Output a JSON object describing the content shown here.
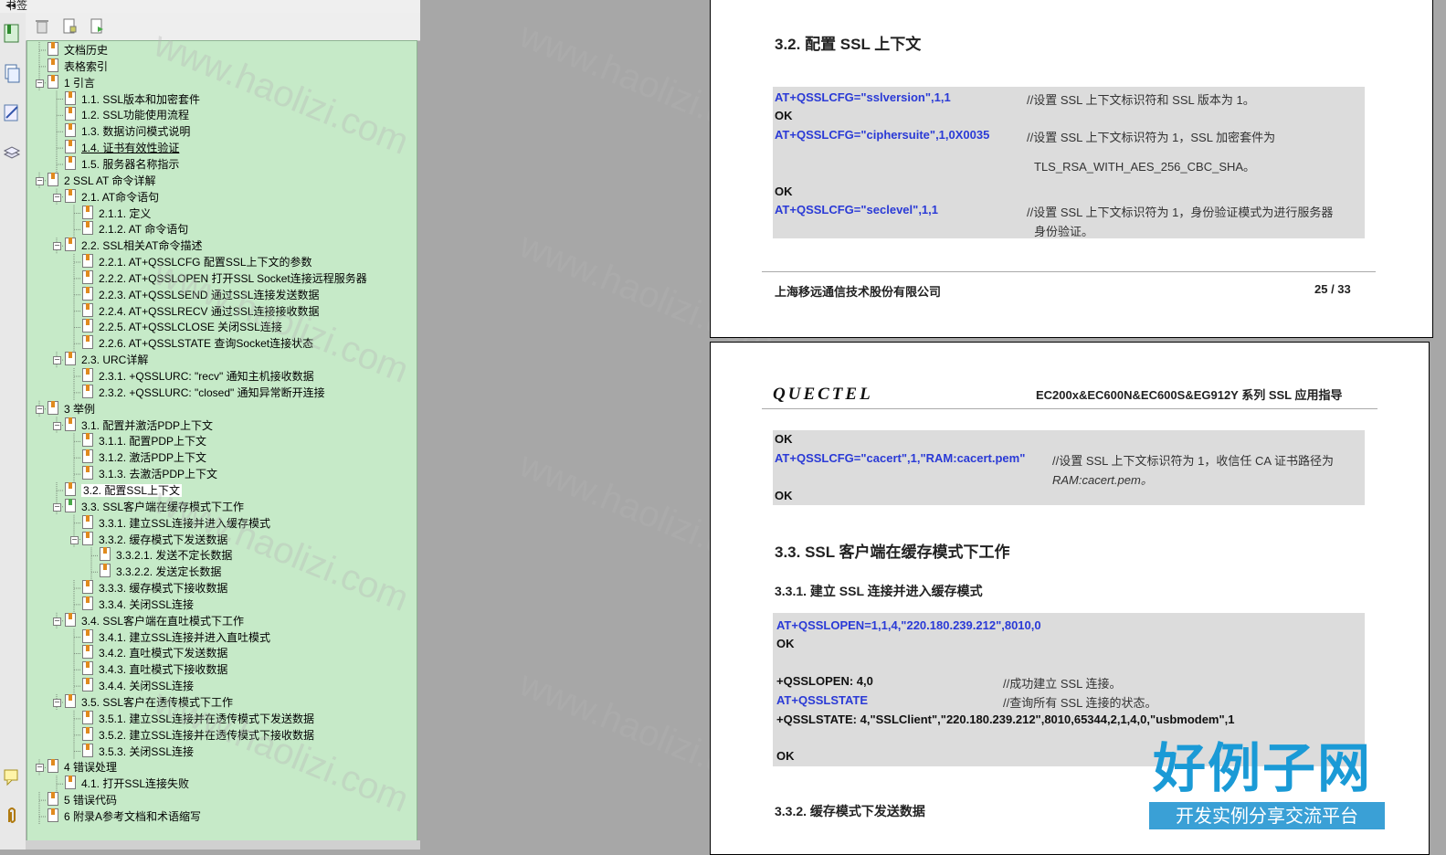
{
  "panel": {
    "title": "书签",
    "collapse_icon": "double-left-arrow"
  },
  "toolbar": {
    "icons": [
      "delete-bookmark-icon",
      "expand-bookmark-icon",
      "new-bookmark-icon"
    ]
  },
  "strip_icons": [
    "bookmarks-icon",
    "pages-icon",
    "signatures-icon",
    "layers-icon",
    "comments-icon",
    "attachments-icon"
  ],
  "bookmarks": [
    {
      "label": "文档历史",
      "level": 0,
      "toggle": ""
    },
    {
      "label": "表格索引",
      "level": 0,
      "toggle": ""
    },
    {
      "label": "1 引言",
      "level": 0,
      "toggle": "−"
    },
    {
      "label": "1.1. SSL版本和加密套件",
      "level": 1,
      "toggle": ""
    },
    {
      "label": "1.2. SSL功能使用流程",
      "level": 1,
      "toggle": ""
    },
    {
      "label": "1.3. 数据访问模式说明",
      "level": 1,
      "toggle": ""
    },
    {
      "label": "1.4. 证书有效性验证",
      "level": 1,
      "toggle": "",
      "underline": true
    },
    {
      "label": "1.5. 服务器名称指示",
      "level": 1,
      "toggle": ""
    },
    {
      "label": "2 SSL AT 命令详解",
      "level": 0,
      "toggle": "−"
    },
    {
      "label": "2.1. AT命令语句",
      "level": 1,
      "toggle": "−"
    },
    {
      "label": "2.1.1. 定义",
      "level": 2,
      "toggle": ""
    },
    {
      "label": "2.1.2. AT 命令语句",
      "level": 2,
      "toggle": ""
    },
    {
      "label": "2.2. SSL相关AT命令描述",
      "level": 1,
      "toggle": "−"
    },
    {
      "label": "2.2.1. AT+QSSLCFG  配置SSL上下文的参数",
      "level": 2,
      "toggle": ""
    },
    {
      "label": "2.2.2. AT+QSSLOPEN  打开SSL Socket连接远程服务器",
      "level": 2,
      "toggle": ""
    },
    {
      "label": "2.2.3. AT+QSSLSEND  通过SSL连接发送数据",
      "level": 2,
      "toggle": ""
    },
    {
      "label": "2.2.4. AT+QSSLRECV  通过SSL连接接收数据",
      "level": 2,
      "toggle": ""
    },
    {
      "label": "2.2.5. AT+QSSLCLOSE  关闭SSL连接",
      "level": 2,
      "toggle": ""
    },
    {
      "label": "2.2.6. AT+QSSLSTATE  查询Socket连接状态",
      "level": 2,
      "toggle": ""
    },
    {
      "label": "2.3. URC详解",
      "level": 1,
      "toggle": "−"
    },
    {
      "label": "2.3.1. +QSSLURC: \"recv\"  通知主机接收数据",
      "level": 2,
      "toggle": ""
    },
    {
      "label": "2.3.2. +QSSLURC: \"closed\"  通知异常断开连接",
      "level": 2,
      "toggle": ""
    },
    {
      "label": "3 举例",
      "level": 0,
      "toggle": "−"
    },
    {
      "label": "3.1. 配置并激活PDP上下文",
      "level": 1,
      "toggle": "−"
    },
    {
      "label": "3.1.1. 配置PDP上下文",
      "level": 2,
      "toggle": ""
    },
    {
      "label": "3.1.2. 激活PDP上下文",
      "level": 2,
      "toggle": ""
    },
    {
      "label": "3.1.3. 去激活PDP上下文",
      "level": 2,
      "toggle": ""
    },
    {
      "label": "3.2. 配置SSL上下文",
      "level": 1,
      "toggle": "",
      "selected": true
    },
    {
      "label": "3.3. SSL客户端在缓存模式下工作",
      "level": 1,
      "toggle": "−",
      "green": true
    },
    {
      "label": "3.3.1. 建立SSL连接并进入缓存模式",
      "level": 2,
      "toggle": ""
    },
    {
      "label": "3.3.2. 缓存模式下发送数据",
      "level": 2,
      "toggle": "−"
    },
    {
      "label": "3.3.2.1. 发送不定长数据",
      "level": 3,
      "toggle": ""
    },
    {
      "label": "3.3.2.2. 发送定长数据",
      "level": 3,
      "toggle": ""
    },
    {
      "label": "3.3.3. 缓存模式下接收数据",
      "level": 2,
      "toggle": ""
    },
    {
      "label": "3.3.4. 关闭SSL连接",
      "level": 2,
      "toggle": ""
    },
    {
      "label": "3.4. SSL客户端在直吐模式下工作",
      "level": 1,
      "toggle": "−"
    },
    {
      "label": "3.4.1. 建立SSL连接并进入直吐模式",
      "level": 2,
      "toggle": ""
    },
    {
      "label": "3.4.2. 直吐模式下发送数据",
      "level": 2,
      "toggle": ""
    },
    {
      "label": "3.4.3. 直吐模式下接收数据",
      "level": 2,
      "toggle": ""
    },
    {
      "label": "3.4.4. 关闭SSL连接",
      "level": 2,
      "toggle": ""
    },
    {
      "label": "3.5. SSL客户在透传模式下工作",
      "level": 1,
      "toggle": "−"
    },
    {
      "label": "3.5.1. 建立SSL连接并在透传模式下发送数据",
      "level": 2,
      "toggle": ""
    },
    {
      "label": "3.5.2. 建立SSL连接并在透传模式下接收数据",
      "level": 2,
      "toggle": ""
    },
    {
      "label": "3.5.3. 关闭SSL连接",
      "level": 2,
      "toggle": ""
    },
    {
      "label": "4 错误处理",
      "level": 0,
      "toggle": "−"
    },
    {
      "label": "4.1. 打开SSL连接失败",
      "level": 1,
      "toggle": ""
    },
    {
      "label": "5 错误代码",
      "level": 0,
      "toggle": ""
    },
    {
      "label": "6 附录A参考文档和术语缩写",
      "level": 0,
      "toggle": ""
    }
  ],
  "page1": {
    "heading": "3.2. 配置 SSL 上下文",
    "cmd1": "AT+QSSLCFG=\"sslversion\",1,1",
    "cmt1": "//设置 SSL 上下文标识符和 SSL 版本为 1。",
    "ok1": "OK",
    "cmd2": "AT+QSSLCFG=\"ciphersuite\",1,0X0035",
    "cmt2": "//设置 SSL 上下文标识符为 1，SSL 加密套件为",
    "cmt2b": "TLS_RSA_WITH_AES_256_CBC_SHA。",
    "ok2": "OK",
    "cmd3": "AT+QSSLCFG=\"seclevel\",1,1",
    "cmt3": "//设置 SSL 上下文标识符为 1，身份验证模式为进行服务器",
    "cmt3b": "身份验证。",
    "company": "上海移远通信技术股份有限公司",
    "page_num": "25 / 33"
  },
  "page2": {
    "logo": "QUECTEL",
    "doc_title": "EC200x&EC600N&EC600S&EG912Y 系列 SSL 应用指导",
    "ok_a": "OK",
    "cmd_cacert": "AT+QSSLCFG=\"cacert\",1,\"RAM:cacert.pem\"",
    "cmt_cacert": "//设置 SSL 上下文标识符为 1，收信任 CA 证书路径为",
    "cmt_cacert_b": "RAM:cacert.pem。",
    "ok_b": "OK",
    "h33": "3.3. SSL 客户端在缓存模式下工作",
    "h331": "3.3.1.   建立 SSL 连接并进入缓存模式",
    "cmd_open": "AT+QSSLOPEN=1,1,4,\"220.180.239.212\",8010,0",
    "ok_c": "OK",
    "urc_open": "+QSSLOPEN: 4,0",
    "cmt_open": "//成功建立 SSL 连接。",
    "cmd_state": "AT+QSSLSTATE",
    "cmt_state": "//查询所有 SSL 连接的状态。",
    "resp_state": "+QSSLSTATE: 4,\"SSLClient\",\"220.180.239.212\",8010,65344,2,1,4,0,\"usbmodem\",1",
    "ok_d": "OK",
    "h332": "3.3.2.   缓存模式下发送数据"
  },
  "watermark": "www.haolizi.com",
  "site_logo": {
    "name": "好例子网",
    "slogan": "开发实例分享交流平台"
  }
}
